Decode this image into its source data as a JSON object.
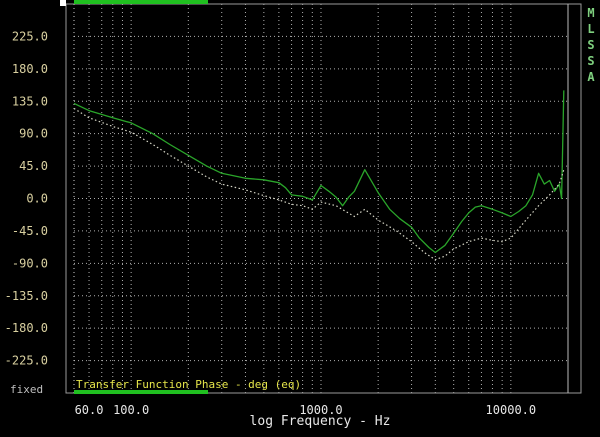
{
  "app": {
    "vertical_title": [
      "M",
      "L",
      "S",
      "S",
      "A"
    ],
    "scale_mode": "fixed"
  },
  "colors": {
    "background": "#000000",
    "frame": "#9a9a9a",
    "grid": "#cfcfcf",
    "series_solid": "#2aa52a",
    "series_dotted": "#d8d8c8",
    "range_bar": "#20c020",
    "caption": "#e6e64a",
    "ytick": "#d9d0a0",
    "xtick": "#e8e8e8"
  },
  "chart_data": {
    "type": "line",
    "title": "Transfer Function Phase - deg (eq)",
    "xlabel": "log Frequency - Hz",
    "ylabel": "",
    "xscale": "log",
    "xlim": [
      50,
      20000
    ],
    "ylim": [
      -270,
      270
    ],
    "grid": true,
    "yticks": [
      225.0,
      180.0,
      135.0,
      90.0,
      45.0,
      0.0,
      -45.0,
      -90.0,
      -135.0,
      -180.0,
      -225.0
    ],
    "ytick_labels": [
      "225.0",
      "180.0",
      "135.0",
      "90.0",
      "45.0",
      "0.0",
      "-45.0",
      "-90.0",
      "-135.0",
      "-180.0",
      "-225.0"
    ],
    "xtick_labels": [
      {
        "value": 60,
        "label": "60.0"
      },
      {
        "value": 100,
        "label": "100.0"
      },
      {
        "value": 1000,
        "label": "1000.0"
      },
      {
        "value": 10000,
        "label": "10000.0"
      }
    ],
    "series": [
      {
        "style": "solid",
        "x": [
          50,
          60,
          80,
          100,
          130,
          160,
          200,
          250,
          300,
          400,
          500,
          600,
          650,
          700,
          800,
          900,
          1000,
          1100,
          1200,
          1300,
          1400,
          1500,
          1700,
          2000,
          2300,
          2600,
          3000,
          3300,
          3700,
          4000,
          4500,
          5000,
          5500,
          6000,
          6500,
          7000,
          8000,
          9000,
          10000,
          11000,
          12000,
          13000,
          14000,
          15000,
          16000,
          17000,
          18000,
          18500,
          19000
        ],
        "y": [
          132,
          122,
          112,
          105,
          90,
          75,
          60,
          45,
          35,
          28,
          26,
          22,
          15,
          5,
          3,
          -2,
          18,
          10,
          2,
          -10,
          2,
          10,
          40,
          8,
          -15,
          -28,
          -40,
          -55,
          -68,
          -75,
          -65,
          -48,
          -32,
          -20,
          -12,
          -10,
          -15,
          -20,
          -25,
          -18,
          -10,
          5,
          35,
          20,
          25,
          10,
          20,
          0,
          150
        ]
      },
      {
        "style": "dotted",
        "x": [
          50,
          60,
          80,
          100,
          130,
          160,
          200,
          250,
          300,
          400,
          500,
          600,
          700,
          800,
          900,
          1000,
          1200,
          1500,
          1700,
          2000,
          2500,
          3000,
          3500,
          4000,
          4500,
          5000,
          6000,
          7000,
          8000,
          9000,
          10000,
          12000,
          14000,
          16000,
          18000,
          19000
        ],
        "y": [
          125,
          112,
          100,
          92,
          75,
          60,
          45,
          30,
          20,
          12,
          4,
          -2,
          -8,
          -10,
          -15,
          -5,
          -10,
          -25,
          -15,
          -30,
          -45,
          -60,
          -75,
          -85,
          -80,
          -70,
          -60,
          -55,
          -58,
          -60,
          -55,
          -30,
          -10,
          5,
          20,
          40
        ]
      }
    ]
  }
}
